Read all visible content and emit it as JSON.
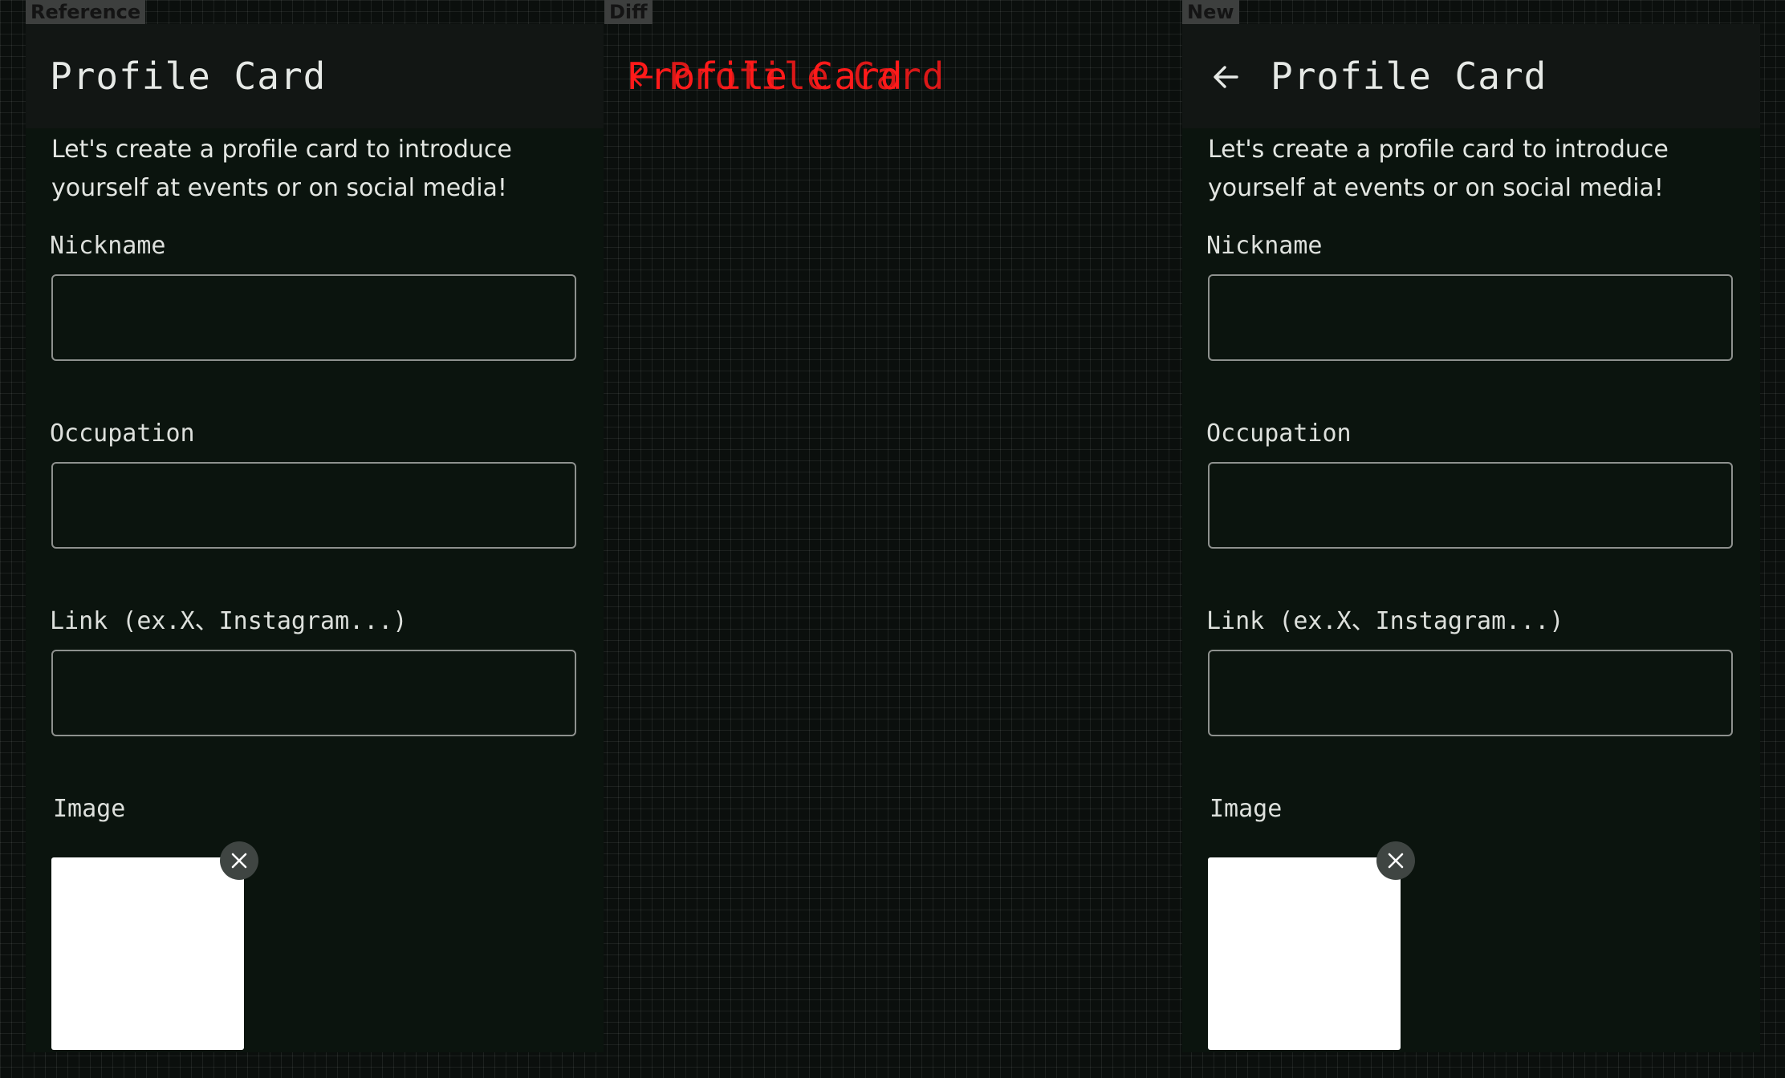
{
  "labels": {
    "reference": "Reference",
    "diff": "Diff",
    "new": "New"
  },
  "app": {
    "title": "Profile Card",
    "intro": "Let's create a profile card to introduce yourself at events or on social media!",
    "fields": {
      "nickname": {
        "label": "Nickname",
        "value": ""
      },
      "occupation": {
        "label": "Occupation",
        "value": ""
      },
      "link": {
        "label": "Link (ex.X、Instagram...)",
        "value": ""
      }
    },
    "image_label": "Image"
  },
  "icons": {
    "back": "arrow-back-icon",
    "remove": "close-icon"
  },
  "colors": {
    "background": "#0b0f0d",
    "panel": "#0b140e",
    "appbar": "#121614",
    "text": "#e6e9e6",
    "field_border": "#8e918e",
    "diff_highlight": "#ff1a1a",
    "remove_button": "#3f4542"
  }
}
